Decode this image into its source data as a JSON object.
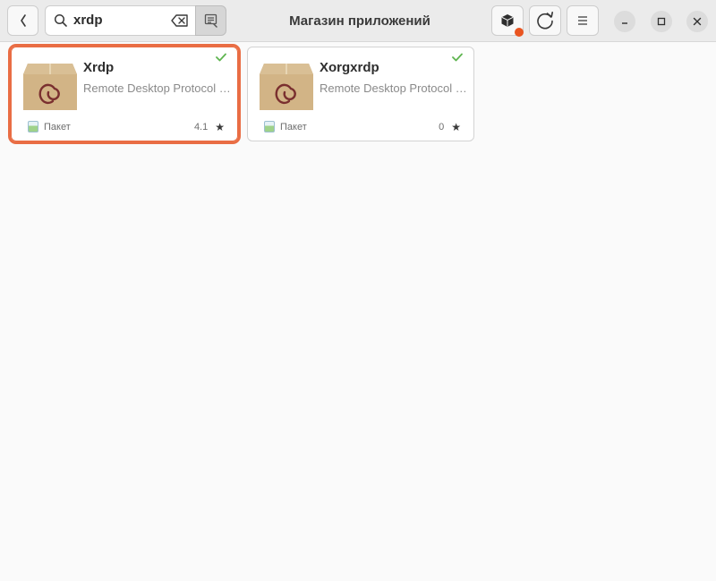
{
  "header": {
    "title": "Магазин приложений",
    "search": {
      "value": "xrdp"
    }
  },
  "icons": {
    "back": "chevron-left-icon",
    "search": "search-icon",
    "clear": "backspace-icon",
    "search_toggle": "search-list-icon",
    "install": "package-icon",
    "refresh": "refresh-icon",
    "menu": "hamburger-menu-icon",
    "minimize": "minimize-icon",
    "maximize": "maximize-icon",
    "close": "close-icon",
    "installed": "checkmark-icon",
    "star": "star-icon"
  },
  "colors": {
    "accent": "#e95420",
    "selection": "#e96d44",
    "installed_check": "#5fb550"
  },
  "results": [
    {
      "name": "Xrdp",
      "description": "Remote Desktop Protocol (RDP) server",
      "source": "Пакет",
      "rating": "4.1",
      "installed": true,
      "selected": true
    },
    {
      "name": "Xorgxrdp",
      "description": "Remote Desktop Protocol (RDP) modules for X.org",
      "source": "Пакет",
      "rating": "0",
      "installed": true,
      "selected": false
    }
  ]
}
